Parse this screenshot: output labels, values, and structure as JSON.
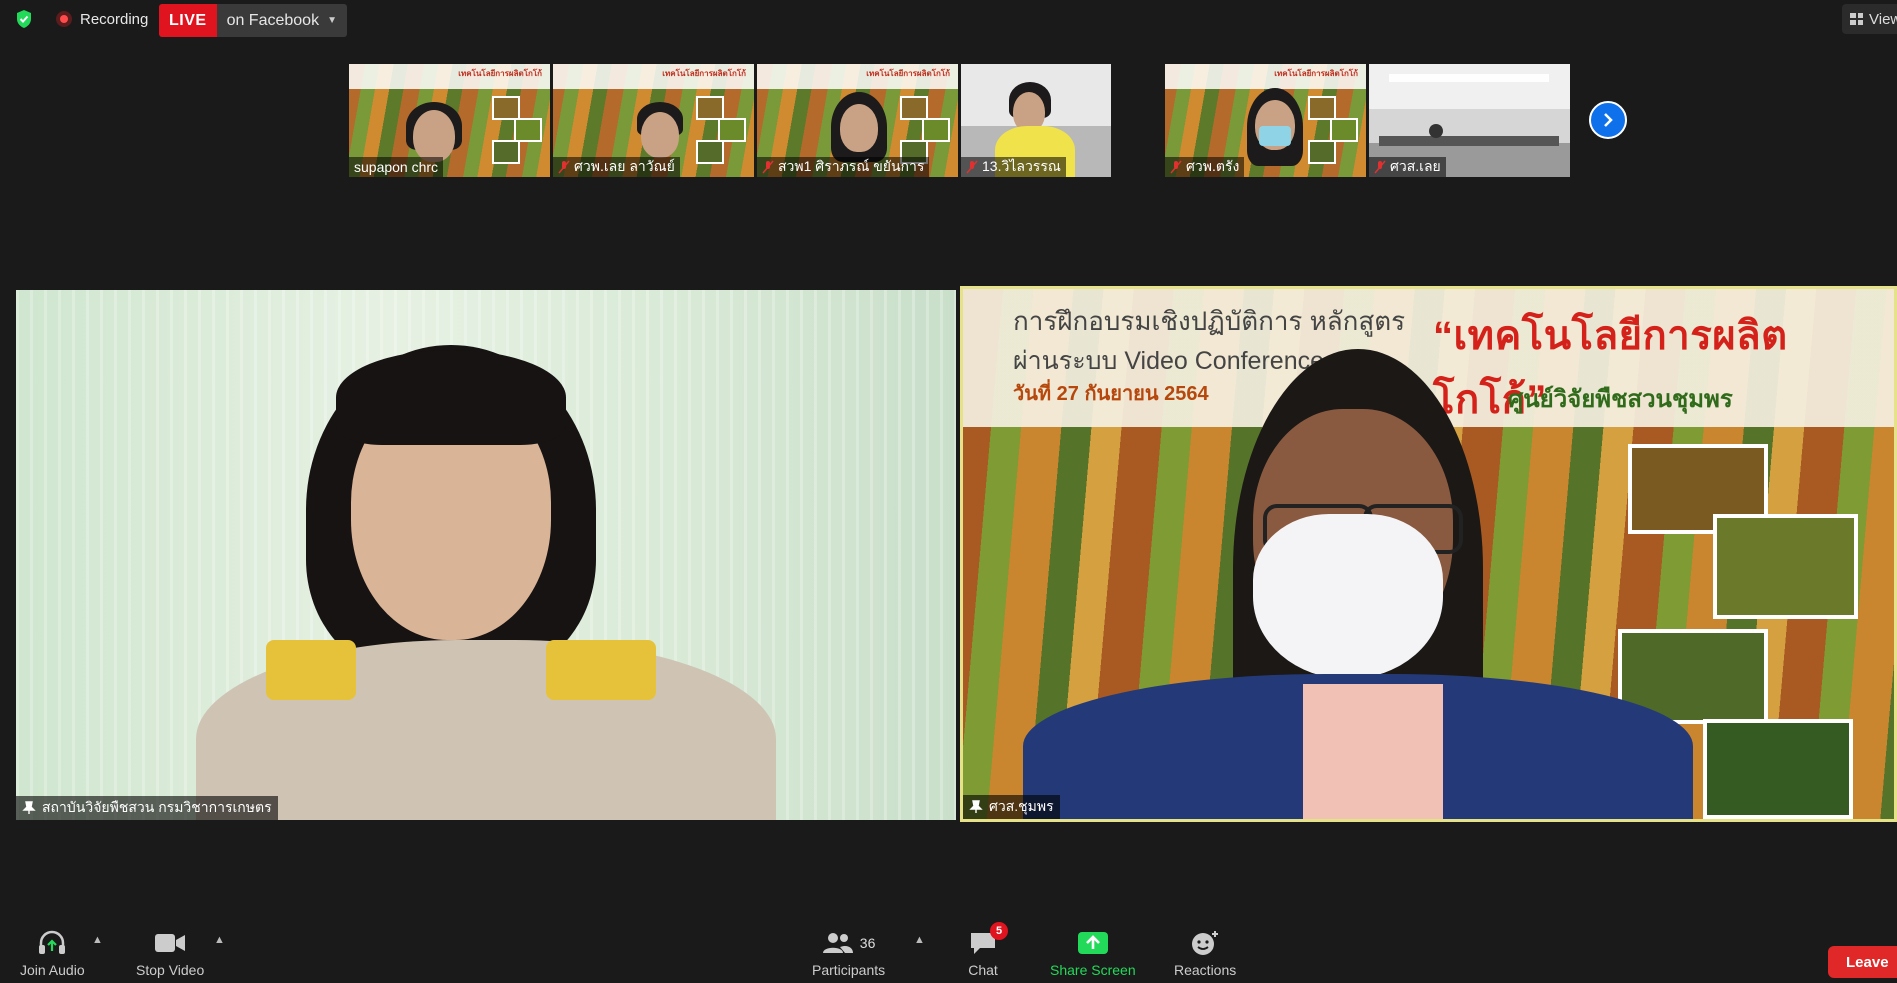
{
  "topbar": {
    "recording_label": "Recording",
    "live_badge": "LIVE",
    "live_destination": "on Facebook",
    "view_label": "View"
  },
  "thumbnails": [
    {
      "name": "supapon chrc",
      "muted": false,
      "background": "cocoa"
    },
    {
      "name": "ศวพ.เลย ลาวัณย์",
      "muted": true,
      "background": "cocoa"
    },
    {
      "name": "สวพ1 ศิราภรณ์ ขยันการ",
      "muted": true,
      "background": "cocoa"
    },
    {
      "name": "13.วิไลวรรณ",
      "muted": true,
      "background": "room"
    },
    {
      "name": "ศวพ.ตรัง",
      "muted": true,
      "background": "cocoa"
    },
    {
      "name": "ศวส.เลย",
      "muted": true,
      "background": "office"
    }
  ],
  "main_tiles": {
    "left": {
      "name": "สถาบันวิจัยพืชสวน กรมวิชาการเกษตร"
    },
    "right": {
      "name": "ศวส.ชุมพร",
      "banner_line1": "การฝึกอบรมเชิงปฏิบัติการ หลักสูตร",
      "banner_line2": "ผ่านระบบ Video Conference",
      "banner_date": "วันที่ 27 กันยายน 2564",
      "banner_title": "“เทคโนโลยีการผลิตโกโก้”",
      "banner_org": "ศูนย์วิจัยพืชสวนชุมพร"
    }
  },
  "toolbar": {
    "join_audio": "Join Audio",
    "stop_video": "Stop Video",
    "participants": "Participants",
    "participants_count": "36",
    "chat": "Chat",
    "chat_badge": "5",
    "share_screen": "Share Screen",
    "reactions": "Reactions",
    "leave": "Leave"
  },
  "colors": {
    "live_red": "#e0141f",
    "share_green": "#23d959",
    "next_blue": "#0e71eb",
    "active_speaker_border": "#e6e28a"
  }
}
